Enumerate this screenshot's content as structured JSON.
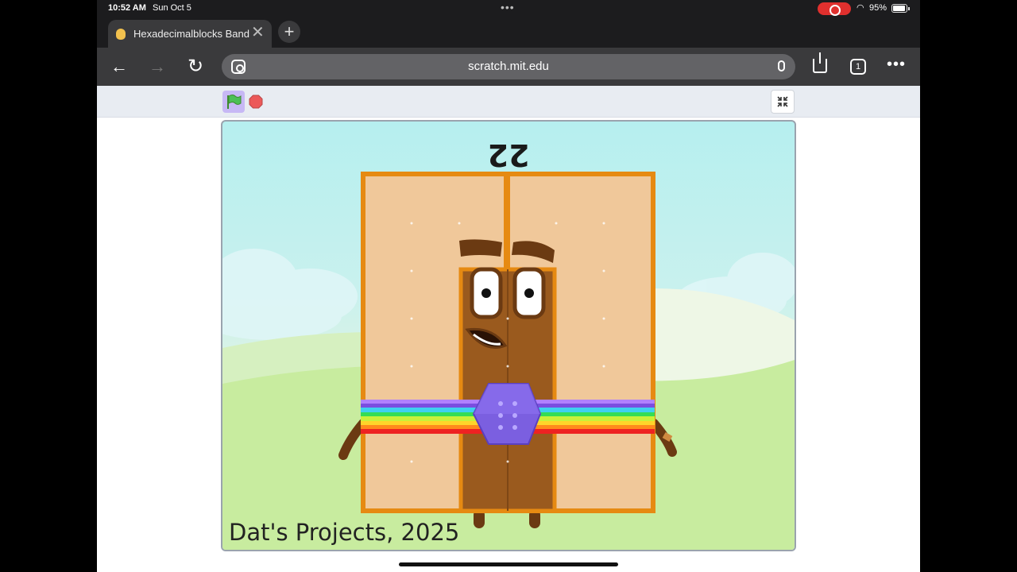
{
  "status_bar": {
    "time": "10:52 AM",
    "date": "Sun Oct 5",
    "battery": "95%"
  },
  "tab": {
    "title": "Hexadecimalblocks Band",
    "close_symbol": "✕",
    "new_tab_symbol": "+"
  },
  "toolbar": {
    "back_symbol": "←",
    "forward_symbol": "→",
    "reload_symbol": "↻",
    "url": "scratch.mit.edu",
    "tab_count": "1",
    "more_symbol": "•••"
  },
  "stage": {
    "number": "22",
    "credit": "Dat's Projects, 2025"
  },
  "colors": {
    "accent": "#3a3a3c",
    "record": "#e0302e",
    "block_orange": "#e68a12",
    "block_peach": "#f0c89a",
    "block_brown": "#9a5a1e",
    "gem_purple": "#7b5fe0"
  },
  "icons": [
    "battery-icon",
    "record-icon",
    "wifi-icon",
    "favicon-icon",
    "lens-icon",
    "mic-icon",
    "share-icon",
    "green-flag-icon",
    "stop-icon",
    "fullscreen-exit-icon"
  ]
}
